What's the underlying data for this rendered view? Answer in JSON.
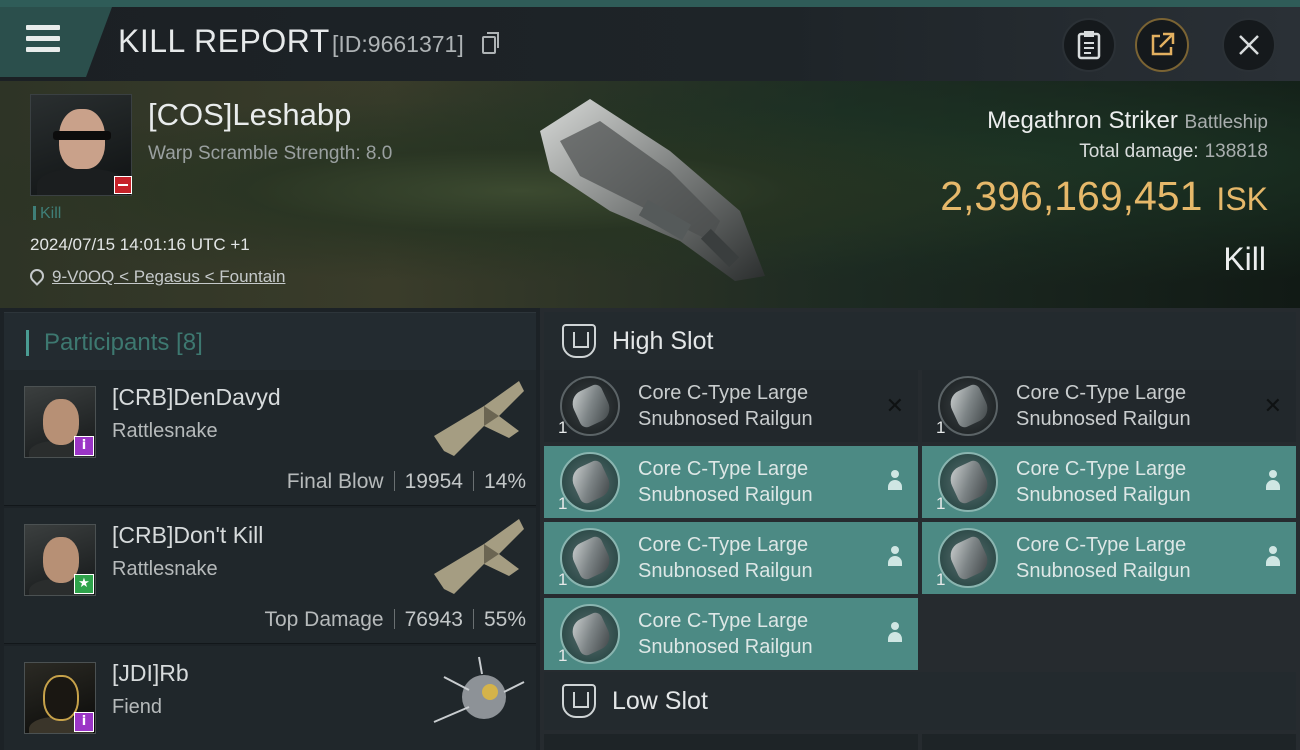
{
  "header": {
    "title": "KILL REPORT",
    "report_id": "[ID:9661371]",
    "buttons": [
      "clipboard-icon",
      "share-icon",
      "close-icon"
    ]
  },
  "victim": {
    "name": "[COS]Leshabp",
    "warp_scramble": "Warp Scramble Strength: 8.0",
    "tag": "Kill",
    "datetime": "2024/07/15 14:01:16 UTC +1",
    "location": "9-V0OQ < Pegasus < Fountain"
  },
  "ship": {
    "name": "Megathron Striker",
    "class": "Battleship",
    "total_damage_label": "Total damage:",
    "total_damage": "138818",
    "isk_value": "2,396,169,451",
    "isk_unit": "ISK",
    "result": "Kill"
  },
  "participants": {
    "title": "Participants [8]",
    "items": [
      {
        "name": "[CRB]DenDavyd",
        "ship": "Rattlesnake",
        "role": "Final Blow",
        "damage": "19954",
        "percent": "14%",
        "badge": "i"
      },
      {
        "name": "[CRB]Don't Kill",
        "ship": "Rattlesnake",
        "role": "Top Damage",
        "damage": "76943",
        "percent": "55%",
        "badge": "★"
      },
      {
        "name": "[JDI]Rb",
        "ship": "Fiend",
        "badge": "i"
      }
    ]
  },
  "high_slot": {
    "title": "High Slot",
    "modules": [
      {
        "name": "Core C-Type Large Snubnosed Railgun",
        "qty": "1",
        "status": "destroyed"
      },
      {
        "name": "Core C-Type Large Snubnosed Railgun",
        "qty": "1",
        "status": "destroyed"
      },
      {
        "name": "Core C-Type Large Snubnosed Railgun",
        "qty": "1",
        "status": "dropped"
      },
      {
        "name": "Core C-Type Large Snubnosed Railgun",
        "qty": "1",
        "status": "dropped"
      },
      {
        "name": "Core C-Type Large Snubnosed Railgun",
        "qty": "1",
        "status": "dropped"
      },
      {
        "name": "Core C-Type Large Snubnosed Railgun",
        "qty": "1",
        "status": "dropped"
      },
      {
        "name": "Core C-Type Large Snubnosed Railgun",
        "qty": "1",
        "status": "dropped"
      }
    ]
  },
  "low_slot": {
    "title": "Low Slot"
  },
  "colors": {
    "accent_teal": "#4c8a84",
    "isk_gold": "#e6b86a",
    "background": "#161a1e"
  }
}
